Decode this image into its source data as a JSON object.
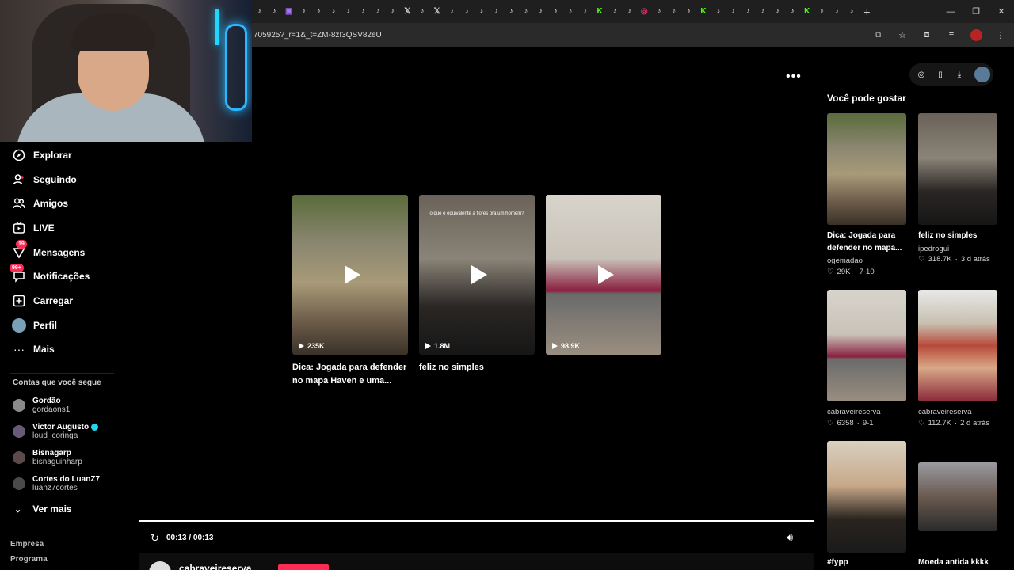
{
  "browser": {
    "url": "705925?_r=1&_t=ZM-8zI3QSV82eU",
    "tab_count": 44,
    "new_tab": "+"
  },
  "sidebar": {
    "nav": [
      {
        "label": "Explorar",
        "icon": "compass-icon"
      },
      {
        "label": "Seguindo",
        "icon": "user-follow-icon"
      },
      {
        "label": "Amigos",
        "icon": "friends-icon"
      },
      {
        "label": "LIVE",
        "icon": "live-icon"
      },
      {
        "label": "Mensagens",
        "icon": "messages-icon",
        "badge": "19"
      },
      {
        "label": "Notificações",
        "icon": "notifications-icon",
        "badge": "99+"
      },
      {
        "label": "Carregar",
        "icon": "upload-icon"
      },
      {
        "label": "Perfil",
        "icon": "profile-avatar"
      },
      {
        "label": "Mais",
        "icon": "more-icon"
      }
    ],
    "following_title": "Contas que você segue",
    "accounts": [
      {
        "name": "Gordão",
        "handle": "gordaons1",
        "verified": false
      },
      {
        "name": "Victor Augusto",
        "handle": "loud_coringa",
        "verified": true
      },
      {
        "name": "Bisnagarp",
        "handle": "bisnaguinharp",
        "verified": false
      },
      {
        "name": "Cortes do LuanZ7",
        "handle": "luanz7cortes",
        "verified": false
      }
    ],
    "see_more": "Ver mais",
    "footer": [
      "Empresa",
      "Programa"
    ]
  },
  "main": {
    "videos": [
      {
        "views": "235K",
        "title": "Dica: Jogada para defender no mapa Haven e uma..."
      },
      {
        "views": "1.8M",
        "title": "feliz no simples",
        "overlay_text": "o que é equivalente a flores pra um homem?"
      },
      {
        "views": "98.9K",
        "title": ""
      }
    ],
    "time": "00:13 / 00:13",
    "progress": 1.0,
    "username": "cabraveireserva"
  },
  "suggestions": {
    "title": "Você pode gostar",
    "items": [
      {
        "title": "Dica: Jogada para defender no mapa...",
        "author": "ogemadao",
        "likes": "29K",
        "date": "7-10"
      },
      {
        "title": "feliz no simples",
        "author": "ipedrogui",
        "likes": "318.7K",
        "date": "3 d atrás"
      },
      {
        "title": "",
        "author": "cabraveireserva",
        "likes": "6358",
        "date": "9-1"
      },
      {
        "title": "",
        "author": "cabraveireserva",
        "likes": "112.7K",
        "date": "2 d atrás"
      },
      {
        "title": "#fypp",
        "author": "",
        "likes": "",
        "date": ""
      },
      {
        "title": "Moeda antida kkkk",
        "author": "",
        "likes": "",
        "date": ""
      }
    ]
  },
  "colors": {
    "accent": "#fe2c55",
    "background": "#000000",
    "verified": "#20d5ec"
  }
}
